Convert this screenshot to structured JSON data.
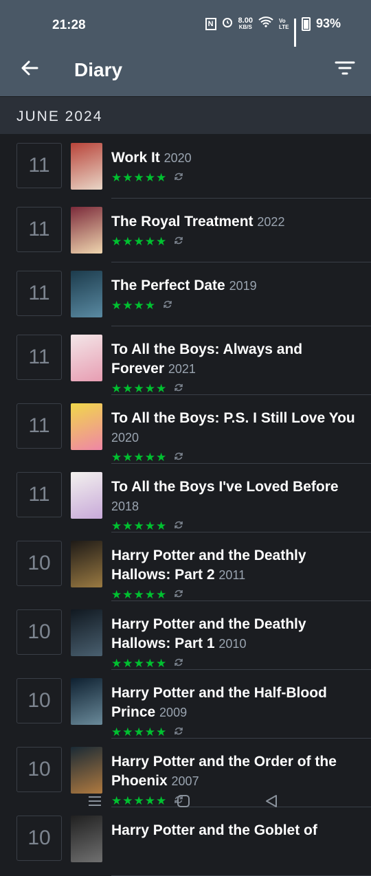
{
  "status_bar": {
    "time": "21:28",
    "nfc": "N",
    "speed_value": "8.00",
    "speed_unit": "KB/S",
    "volte": "Vo LTE",
    "battery": "93%"
  },
  "app_bar": {
    "title": "Diary",
    "back_icon": "arrow-left-icon",
    "filter_icon": "filter-icon"
  },
  "section": {
    "month": "JUNE 2024"
  },
  "colors": {
    "header_bg": "#4a5866",
    "page_bg": "#1b1d21",
    "stars": "#00c030"
  },
  "entries": [
    {
      "day": "11",
      "title": "Work It",
      "year": "2020",
      "stars": "★★★★★",
      "rating": 5,
      "rewatch": true
    },
    {
      "day": "11",
      "title": "The Royal Treatment",
      "year": "2022",
      "stars": "★★★★★",
      "rating": 5,
      "rewatch": true
    },
    {
      "day": "11",
      "title": "The Perfect Date",
      "year": "2019",
      "stars": "★★★★",
      "rating": 4,
      "rewatch": true
    },
    {
      "day": "11",
      "title": "To All the Boys: Always and Forever",
      "year": "2021",
      "stars": "★★★★★",
      "rating": 5,
      "rewatch": true
    },
    {
      "day": "11",
      "title": "To All the Boys: P.S. I Still Love You",
      "year": "2020",
      "stars": "★★★★★",
      "rating": 5,
      "rewatch": true
    },
    {
      "day": "11",
      "title": "To All the Boys I've Loved Before",
      "year": "2018",
      "stars": "★★★★★",
      "rating": 5,
      "rewatch": true
    },
    {
      "day": "10",
      "title": "Harry Potter and the Deathly Hallows: Part 2",
      "year": "2011",
      "stars": "★★★★★",
      "rating": 5,
      "rewatch": true
    },
    {
      "day": "10",
      "title": "Harry Potter and the Deathly Hallows: Part 1",
      "year": "2010",
      "stars": "★★★★★",
      "rating": 5,
      "rewatch": true
    },
    {
      "day": "10",
      "title": "Harry Potter and the Half-Blood Prince",
      "year": "2009",
      "stars": "★★★★★",
      "rating": 5,
      "rewatch": true
    },
    {
      "day": "10",
      "title": "Harry Potter and the Order of the Phoenix",
      "year": "2007",
      "stars": "★★★★★",
      "rating": 5,
      "rewatch": true
    },
    {
      "day": "10",
      "title": "Harry Potter and the Goblet of",
      "year": "",
      "stars": "",
      "rating": null,
      "rewatch": false
    }
  ],
  "nav_bar": {
    "menu_icon": "menu-icon",
    "home_icon": "home-square-icon",
    "back_icon": "back-triangle-icon"
  }
}
